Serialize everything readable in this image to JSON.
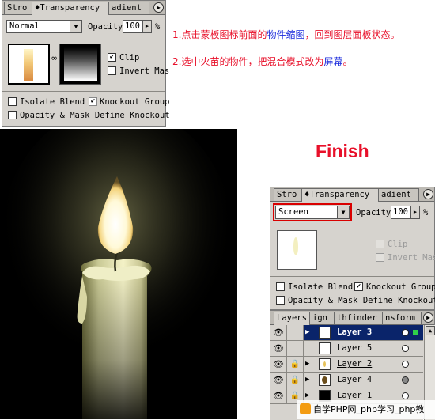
{
  "top_panel": {
    "tabs": [
      "Stro",
      "♦Transparency",
      "adient"
    ],
    "blend_mode": "Normal",
    "opacity_label": "Opacity",
    "opacity_value": "100",
    "percent": "%",
    "clip_label": "Clip",
    "invert_mask_label": "Invert Mas",
    "isolate_blend_label": "Isolate Blend",
    "knockout_group_label": "Knockout Group",
    "opacity_mask_label": "Opacity & Mask Define Knockout"
  },
  "instructions": {
    "step1": "1.点击蒙板图标前面的",
    "step1_highlight": "物件缩图",
    "step1_rest": "，回到图层面板状态。",
    "step2": "2.选中火苗的物件，把混合模式改为",
    "step2_highlight": "屏幕",
    "step2_rest": "。"
  },
  "finish_label": "Finish",
  "bottom_panel": {
    "tabs": [
      "Stro",
      "♦Transparency",
      "adient"
    ],
    "blend_mode": "Screen",
    "opacity_label": "Opacity",
    "opacity_value": "100",
    "percent": "%",
    "clip_label": "Clip",
    "invert_mask_label": "Invert Mas",
    "isolate_blend_label": "Isolate Blend",
    "knockout_group_label": "Knockout Group",
    "opacity_mask_label": "Opacity & Mask Define Knockout"
  },
  "layers_panel": {
    "tabs": [
      "Layers",
      "ign",
      "thfinder",
      "nsform"
    ],
    "layers": [
      {
        "name": "Layer 3",
        "selected": true
      },
      {
        "name": "Layer 5",
        "selected": false
      },
      {
        "name": "Layer 2",
        "selected": false
      },
      {
        "name": "Layer 4",
        "selected": false
      },
      {
        "name": "Layer 1",
        "selected": false
      }
    ]
  },
  "watermark": "自学PHP网_php学习_php教",
  "colors": {
    "instruction_red": "#e8102a",
    "instruction_blue": "#1a2adc",
    "finish_red": "#e8102a",
    "selection_blue": "#0a246a",
    "highlight_box": "#d90000"
  }
}
